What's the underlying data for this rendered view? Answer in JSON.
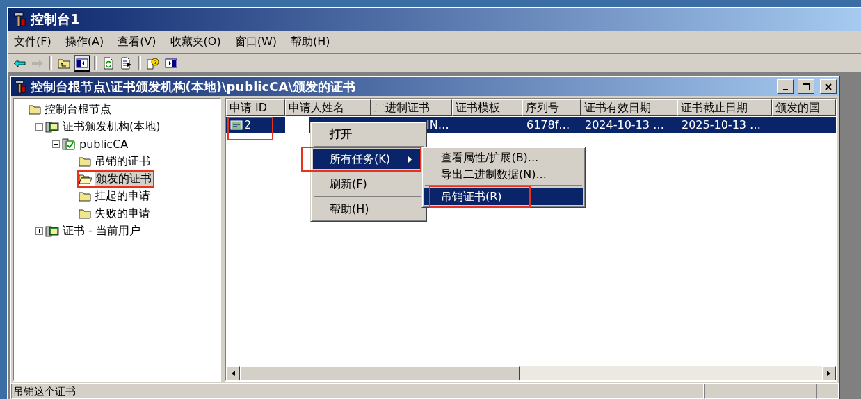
{
  "window": {
    "title": "控制台1"
  },
  "menu": [
    "文件(F)",
    "操作(A)",
    "查看(V)",
    "收藏夹(O)",
    "窗口(W)",
    "帮助(H)"
  ],
  "toolbar": [
    {
      "kind": "back",
      "disabled": false,
      "pressed": false
    },
    {
      "kind": "forward",
      "disabled": true,
      "pressed": false
    },
    {
      "kind": "sep"
    },
    {
      "kind": "up",
      "disabled": false,
      "pressed": false
    },
    {
      "kind": "tree",
      "disabled": false,
      "pressed": true
    },
    {
      "kind": "sep"
    },
    {
      "kind": "refresh",
      "disabled": false,
      "pressed": false
    },
    {
      "kind": "export",
      "disabled": false,
      "pressed": false
    },
    {
      "kind": "sep"
    },
    {
      "kind": "help",
      "disabled": false,
      "pressed": false
    },
    {
      "kind": "pane",
      "disabled": false,
      "pressed": false
    }
  ],
  "child_window": {
    "title": "控制台根节点\\证书颁发机构(本地)\\publicCA\\颁发的证书"
  },
  "tree": [
    {
      "label": "控制台根节点",
      "kind": "folder",
      "selected": false,
      "highlighted": false,
      "children": [
        {
          "label": "证书颁发机构(本地)",
          "kind": "group",
          "selected": false,
          "highlighted": false,
          "expanded": true,
          "children": [
            {
              "label": "publicCA",
              "kind": "ca",
              "selected": false,
              "highlighted": false,
              "expanded": true,
              "children": [
                {
                  "label": "吊销的证书",
                  "kind": "folder",
                  "selected": false,
                  "highlighted": false
                },
                {
                  "label": "颁发的证书",
                  "kind": "openfolder",
                  "selected": true,
                  "highlighted": true
                },
                {
                  "label": "挂起的申请",
                  "kind": "folder",
                  "selected": false,
                  "highlighted": false
                },
                {
                  "label": "失败的申请",
                  "kind": "folder",
                  "selected": false,
                  "highlighted": false
                }
              ]
            }
          ]
        },
        {
          "label": "证书 - 当前用户",
          "kind": "group",
          "selected": false,
          "highlighted": false,
          "expanded": false
        }
      ]
    }
  ],
  "table": {
    "columns": [
      "申请 ID",
      "申请人姓名",
      "二进制证书",
      "证书模板",
      "序列号",
      "证书有效日期",
      "证书截止日期",
      "颁发的国"
    ],
    "rows": [
      {
        "selected": true,
        "highlighted": true,
        "cells": [
          "2",
          "",
          "IN…",
          "",
          "6178f…",
          "2024-10-13 …",
          "2025-10-13 …",
          ""
        ]
      }
    ]
  },
  "context_menu": {
    "items": [
      {
        "kind": "item",
        "label": "打开",
        "bold": true,
        "selected": false,
        "highlighted": false
      },
      {
        "kind": "sep"
      },
      {
        "kind": "submenu",
        "label": "所有任务(K)",
        "bold": false,
        "selected": true,
        "highlighted": true
      },
      {
        "kind": "sep"
      },
      {
        "kind": "item",
        "label": "刷新(F)",
        "bold": false,
        "selected": false,
        "highlighted": false
      },
      {
        "kind": "sep"
      },
      {
        "kind": "item",
        "label": "帮助(H)",
        "bold": false,
        "selected": false,
        "highlighted": false
      }
    ],
    "submenu": [
      {
        "kind": "item",
        "label": "查看属性/扩展(B)...",
        "selected": false,
        "highlighted": false
      },
      {
        "kind": "item",
        "label": "导出二进制数据(N)...",
        "selected": false,
        "highlighted": false
      },
      {
        "kind": "sep"
      },
      {
        "kind": "item",
        "label": "吊销证书(R)",
        "selected": true,
        "highlighted": true
      }
    ]
  },
  "status_bar": {
    "text": "吊销这个证书"
  }
}
